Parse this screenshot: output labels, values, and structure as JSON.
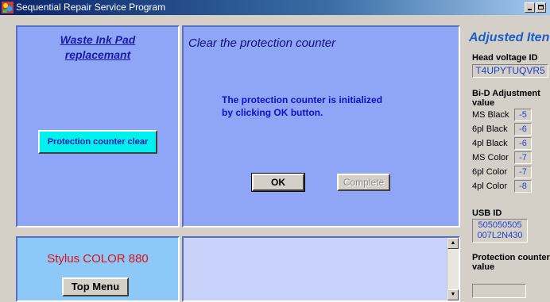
{
  "window": {
    "title": "Sequential Repair Service Program"
  },
  "left_top": {
    "heading_line1": "Waste Ink Pad",
    "heading_line2": "replacemant",
    "button": "Protection counter clear"
  },
  "center_top": {
    "title": "Clear the protection counter",
    "message_line1": "The protection counter is initialized",
    "message_line2": "by clicking OK button.",
    "ok": "OK",
    "complete": "Complete"
  },
  "left_bottom": {
    "model": "Stylus COLOR 880",
    "top_menu": "Top Menu"
  },
  "right": {
    "title": "Adjusted Iten",
    "head_voltage_label": "Head voltage ID",
    "head_voltage_value": "T4UPYTUQVR5",
    "bidi_label_line1": "Bi-D Adjustment",
    "bidi_label_line2": "value",
    "bidi": [
      {
        "name": "MS Black",
        "value": "-5"
      },
      {
        "name": "6pl Black",
        "value": "-6"
      },
      {
        "name": "4pl Black",
        "value": "-6"
      },
      {
        "name": "MS Color",
        "value": "-7"
      },
      {
        "name": "6pl Color",
        "value": "-7"
      },
      {
        "name": "4pl Color",
        "value": "-8"
      }
    ],
    "usb_label": "USB ID",
    "usb_line1": "505050505",
    "usb_line2": "007L2N430",
    "protection_label_line1": "Protection counter",
    "protection_label_line2": "value",
    "protection_value": ""
  }
}
